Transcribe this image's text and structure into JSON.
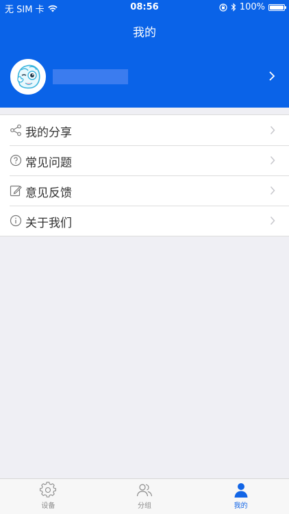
{
  "status_bar": {
    "carrier": "无 SIM 卡",
    "time": "08:56",
    "battery": "100%",
    "battery_level": 1.0
  },
  "header": {
    "title": "我的"
  },
  "profile": {
    "avatar_icon": "cartoon-avatar-icon",
    "chevron_icon": "chevron-right-icon"
  },
  "menu": {
    "items": [
      {
        "label": "我的分享",
        "icon": "share-icon"
      },
      {
        "label": "常见问题",
        "icon": "question-circle-icon"
      },
      {
        "label": "意见反馈",
        "icon": "edit-icon"
      },
      {
        "label": "关于我们",
        "icon": "info-circle-icon"
      }
    ]
  },
  "tabbar": {
    "tabs": [
      {
        "label": "设备",
        "icon": "gear-icon",
        "active": false
      },
      {
        "label": "分组",
        "icon": "users-icon",
        "active": false
      },
      {
        "label": "我的",
        "icon": "person-icon",
        "active": true
      }
    ]
  },
  "colors": {
    "primary_blue": "#0a63e8",
    "active_tab": "#1265e6",
    "background": "#efeff4"
  }
}
